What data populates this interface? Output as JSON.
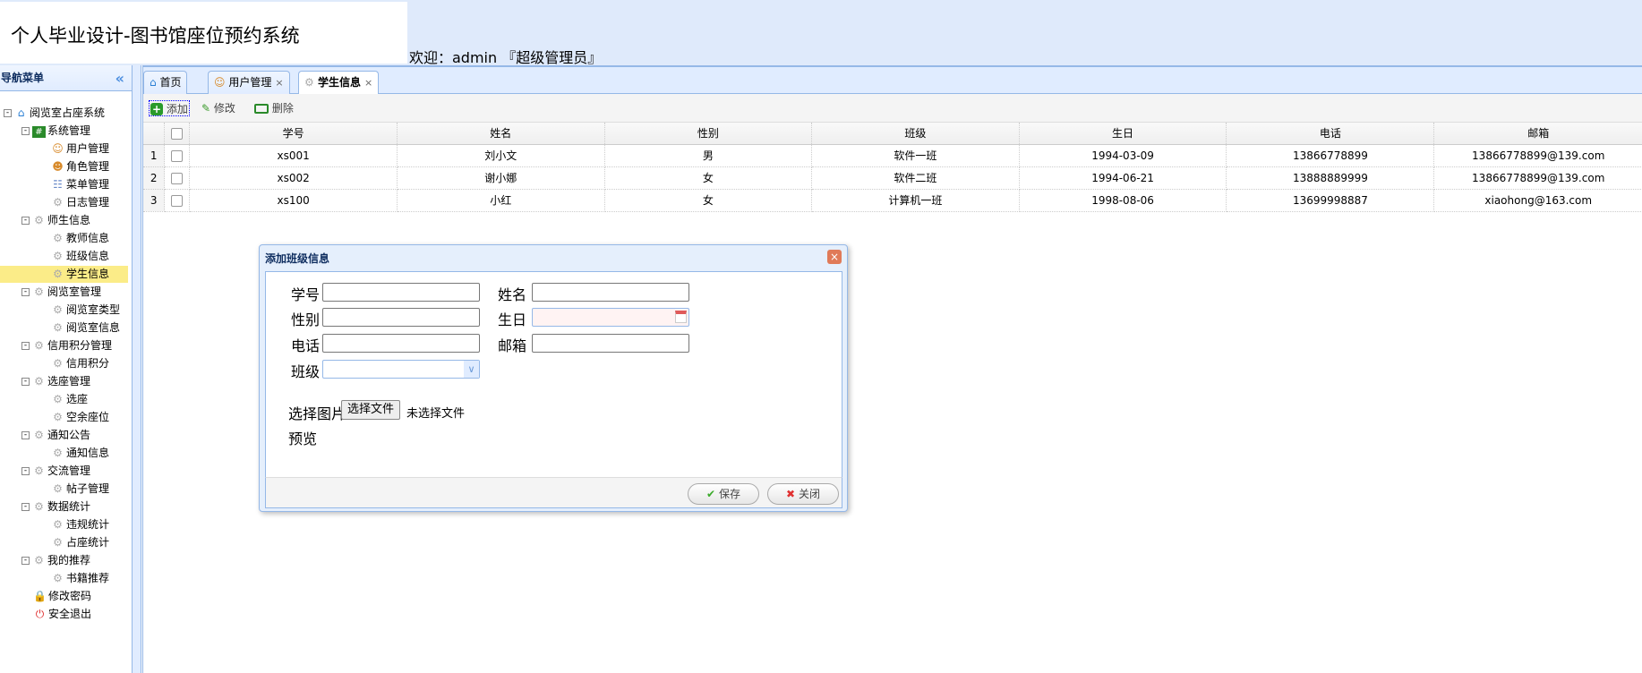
{
  "header": {
    "title": "个人毕业设计-图书馆座位预约系统",
    "welcome": "欢迎：admin 『超级管理员』"
  },
  "sidebar": {
    "title": "导航菜单",
    "collapse_icon": "«",
    "items": [
      {
        "label": "阅览室占座系统",
        "level": 0,
        "icon": "home",
        "toggle": "⊟"
      },
      {
        "label": "系统管理",
        "level": 1,
        "icon": "hash",
        "toggle": "⊟"
      },
      {
        "label": "用户管理",
        "level": 2,
        "icon": "user"
      },
      {
        "label": "角色管理",
        "level": 2,
        "icon": "users"
      },
      {
        "label": "菜单管理",
        "level": 2,
        "icon": "tree"
      },
      {
        "label": "日志管理",
        "level": 2,
        "icon": "gear"
      },
      {
        "label": "师生信息",
        "level": 1,
        "icon": "gear",
        "toggle": "⊟"
      },
      {
        "label": "教师信息",
        "level": 2,
        "icon": "gear"
      },
      {
        "label": "班级信息",
        "level": 2,
        "icon": "gear"
      },
      {
        "label": "学生信息",
        "level": 2,
        "icon": "gear",
        "selected": true
      },
      {
        "label": "阅览室管理",
        "level": 1,
        "icon": "gear",
        "toggle": "⊟"
      },
      {
        "label": "阅览室类型",
        "level": 2,
        "icon": "gear"
      },
      {
        "label": "阅览室信息",
        "level": 2,
        "icon": "gear"
      },
      {
        "label": "信用积分管理",
        "level": 1,
        "icon": "gear",
        "toggle": "⊟"
      },
      {
        "label": "信用积分",
        "level": 2,
        "icon": "gear"
      },
      {
        "label": "选座管理",
        "level": 1,
        "icon": "gear",
        "toggle": "⊟"
      },
      {
        "label": "选座",
        "level": 2,
        "icon": "gear"
      },
      {
        "label": "空余座位",
        "level": 2,
        "icon": "gear"
      },
      {
        "label": "通知公告",
        "level": 1,
        "icon": "gear",
        "toggle": "⊟"
      },
      {
        "label": "通知信息",
        "level": 2,
        "icon": "gear"
      },
      {
        "label": "交流管理",
        "level": 1,
        "icon": "gear",
        "toggle": "⊟"
      },
      {
        "label": "帖子管理",
        "level": 2,
        "icon": "gear"
      },
      {
        "label": "数据统计",
        "level": 1,
        "icon": "gear",
        "toggle": "⊟"
      },
      {
        "label": "违规统计",
        "level": 2,
        "icon": "gear"
      },
      {
        "label": "占座统计",
        "level": 2,
        "icon": "gear"
      },
      {
        "label": "我的推荐",
        "level": 1,
        "icon": "gear",
        "toggle": "⊟"
      },
      {
        "label": "书籍推荐",
        "level": 2,
        "icon": "gear"
      },
      {
        "label": "修改密码",
        "level": 1,
        "icon": "lock"
      },
      {
        "label": "安全退出",
        "level": 1,
        "icon": "power"
      }
    ]
  },
  "tabs": [
    {
      "label": "首页"
    },
    {
      "label": "用户管理",
      "close": "×"
    },
    {
      "label": "学生信息",
      "close": "×"
    }
  ],
  "toolbar": {
    "add": "添加",
    "edit": "修改",
    "delete": "删除"
  },
  "grid": {
    "columns": [
      "学号",
      "姓名",
      "性别",
      "班级",
      "生日",
      "电话",
      "邮箱"
    ],
    "rows": [
      {
        "n": "1",
        "cells": [
          "xs001",
          "刘小文",
          "男",
          "软件一班",
          "1994-03-09",
          "13866778899",
          "13866778899@139.com"
        ]
      },
      {
        "n": "2",
        "cells": [
          "xs002",
          "谢小娜",
          "女",
          "软件二班",
          "1994-06-21",
          "13888889999",
          "13866778899@139.com"
        ]
      },
      {
        "n": "3",
        "cells": [
          "xs100",
          "小红",
          "女",
          "计算机一班",
          "1998-08-06",
          "13699998887",
          "xiaohong@163.com"
        ]
      }
    ]
  },
  "dialog": {
    "title": "添加班级信息",
    "close_icon": "×",
    "fields": {
      "sno": "学号",
      "name": "姓名",
      "gender": "性别",
      "birthday": "生日",
      "phone": "电话",
      "email": "邮箱",
      "class": "班级"
    },
    "picture_label": "选择图片",
    "file_button": "选择文件",
    "file_status": "未选择文件",
    "preview_label": "预览",
    "save": "保存",
    "close": "关闭"
  }
}
